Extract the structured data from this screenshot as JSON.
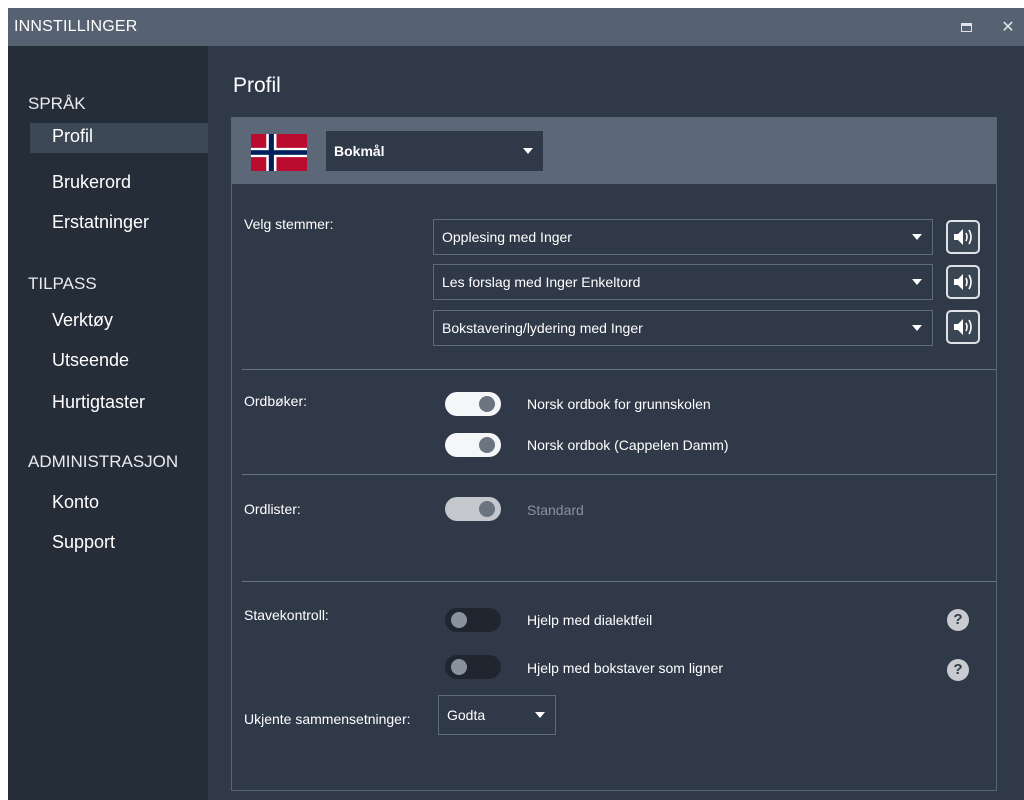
{
  "window": {
    "title": "INNSTILLINGER"
  },
  "sidebar": {
    "sections": [
      {
        "heading": "SPRÅK",
        "items": [
          "Profil",
          "Brukerord",
          "Erstatninger"
        ]
      },
      {
        "heading": "TILPASS",
        "items": [
          "Verktøy",
          "Utseende",
          "Hurtigtaster"
        ]
      },
      {
        "heading": "ADMINISTRASJON",
        "items": [
          "Konto",
          "Support"
        ]
      }
    ],
    "selected": "Profil"
  },
  "main": {
    "title": "Profil",
    "language": {
      "selected": "Bokmål"
    },
    "voices": {
      "label": "Velg stemmer:",
      "options": [
        "Opplesing med Inger",
        "Les forslag med Inger Enkeltord",
        "Bokstavering/lydering med Inger"
      ]
    },
    "dictionaries": {
      "label": "Ordbøker:",
      "items": [
        {
          "name": "Norsk ordbok for grunnskolen",
          "enabled": true
        },
        {
          "name": "Norsk ordbok (Cappelen Damm)",
          "enabled": true
        }
      ]
    },
    "wordlists": {
      "label": "Ordlister:",
      "items": [
        {
          "name": "Standard",
          "enabled": true,
          "disabled": true
        }
      ]
    },
    "spellcheck": {
      "label": "Stavekontroll:",
      "items": [
        {
          "name": "Hjelp med dialektfeil",
          "enabled": false
        },
        {
          "name": "Hjelp med bokstaver som ligner",
          "enabled": false
        }
      ],
      "help_glyph": "?"
    },
    "compounds": {
      "label": "Ukjente sammensetninger:",
      "selected": "Godta"
    }
  },
  "colors": {
    "window_bg": "#2f3948",
    "titlebar_bg": "#566271",
    "sidebar_bg": "#252d38",
    "panel_header_bg": "#5c6878",
    "selected_item_bg": "#3d4857"
  }
}
